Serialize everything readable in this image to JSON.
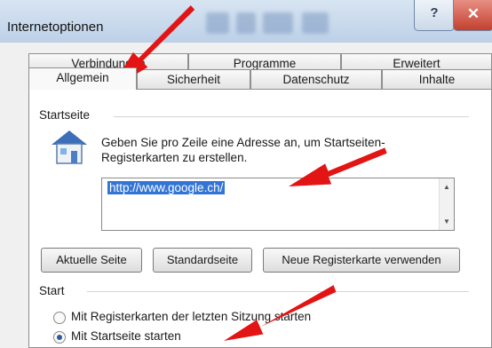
{
  "window": {
    "title": "Internetoptionen",
    "help_glyph": "?",
    "close_glyph": "✕"
  },
  "tabs_back": [
    "Verbindungen",
    "Programme",
    "Erweitert"
  ],
  "tabs_front": [
    "Allgemein",
    "Sicherheit",
    "Datenschutz",
    "Inhalte"
  ],
  "startseite": {
    "group_label": "Startseite",
    "description": "Geben Sie pro Zeile eine Adresse an, um Startseiten-Registerkarten zu erstellen.",
    "url": "http://www.google.ch/",
    "buttons": [
      "Aktuelle Seite",
      "Standardseite",
      "Neue Registerkarte verwenden"
    ]
  },
  "start": {
    "group_label": "Start",
    "options": [
      {
        "label": "Mit Registerkarten der letzten Sitzung starten",
        "selected": false
      },
      {
        "label": "Mit Startseite starten",
        "selected": true
      }
    ]
  },
  "colors": {
    "annotation_arrow": "#e21414",
    "selection": "#3375d6"
  }
}
